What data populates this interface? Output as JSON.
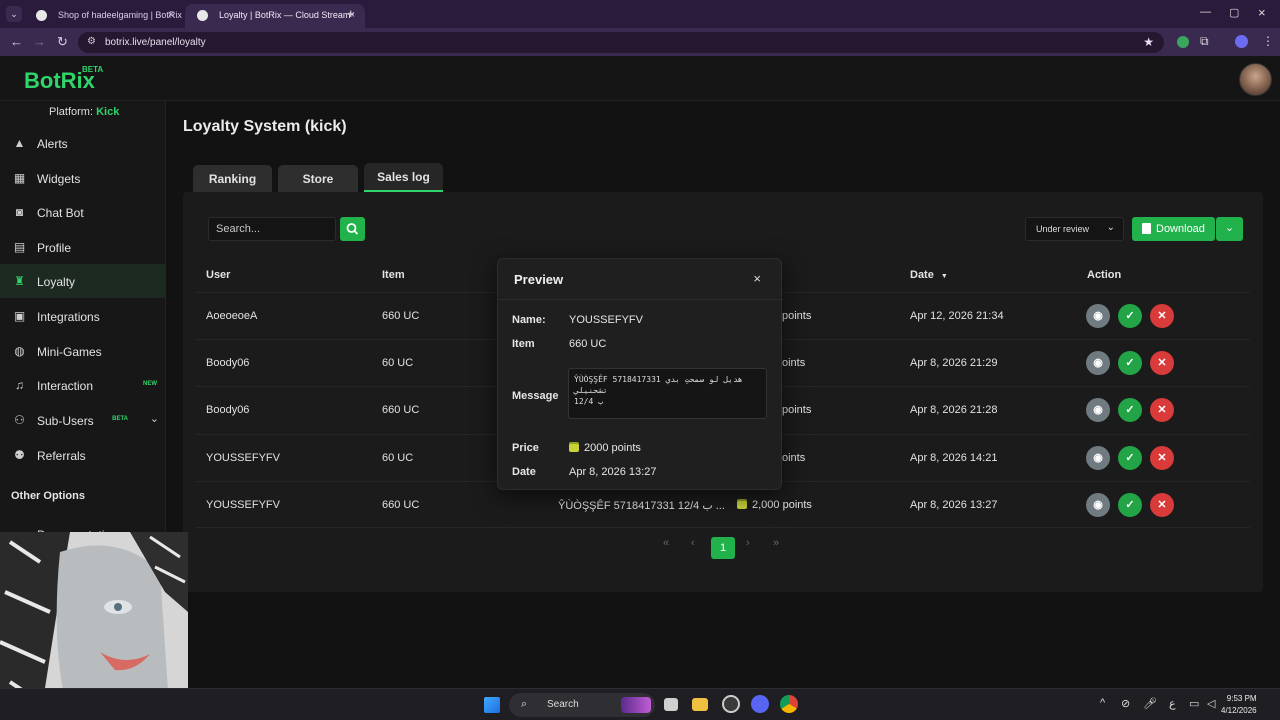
{
  "browser": {
    "tabs": [
      {
        "title": "Shop of hadeelgaming | BotRix"
      },
      {
        "title": "Loyalty | BotRix — Cloud Stream"
      }
    ],
    "url": "botrix.live/panel/loyalty"
  },
  "app": {
    "logo": "BotRix",
    "logo_badge": "BETA",
    "platform_label": "Platform:",
    "platform_value": "Kick"
  },
  "sidebar": {
    "items": [
      {
        "label": "Alerts",
        "icon": "warning-icon"
      },
      {
        "label": "Widgets",
        "icon": "widgets-icon"
      },
      {
        "label": "Chat Bot",
        "icon": "robot-icon"
      },
      {
        "label": "Profile",
        "icon": "profile-card-icon"
      },
      {
        "label": "Loyalty",
        "icon": "trophy-icon"
      },
      {
        "label": "Integrations",
        "icon": "integrations-icon"
      },
      {
        "label": "Mini-Games",
        "icon": "gamepad-icon"
      },
      {
        "label": "Interaction",
        "icon": "music-icon",
        "badge": "NEW"
      },
      {
        "label": "Sub-Users",
        "icon": "users-icon",
        "badge": "BETA"
      },
      {
        "label": "Referrals",
        "icon": "referrals-icon"
      }
    ],
    "section_other": "Other Options",
    "documentation": "Documentation"
  },
  "main": {
    "title": "Loyalty System (kick)",
    "tabs": [
      "Ranking",
      "Store",
      "Sales log"
    ],
    "search_placeholder": "Search...",
    "filter_value": "Under review",
    "download_label": "Download",
    "columns": {
      "user": "User",
      "item": "Item",
      "date": "Date",
      "action": "Action"
    },
    "rows": [
      {
        "user": "AoeoeoeA",
        "item": "660 UC",
        "message": "",
        "price": "points",
        "date": "Apr 12, 2026 21:34"
      },
      {
        "user": "Boody06",
        "item": "60 UC",
        "message": "",
        "price": "oints",
        "date": "Apr 8, 2026 21:29"
      },
      {
        "user": "Boody06",
        "item": "660 UC",
        "message": "",
        "price": "points",
        "date": "Apr 8, 2026 21:28"
      },
      {
        "user": "YOUSSEFYFV",
        "item": "60 UC",
        "message": "",
        "price": "oints",
        "date": "Apr 8, 2026 14:21"
      },
      {
        "user": "YOUSSEFYFV",
        "item": "660 UC",
        "message": "ŶÙÒŞŞÊF 5718417331 12/4 ب ...",
        "price": "2,000 points",
        "date": "Apr 8, 2026 13:27"
      }
    ],
    "pagination": {
      "first": "«",
      "prev": "‹",
      "current": "1",
      "next": "›",
      "last": "»"
    }
  },
  "preview": {
    "title": "Preview",
    "close": "×",
    "name_label": "Name:",
    "name_value": "YOUSSEFYFV",
    "item_label": "Item",
    "item_value": "660 UC",
    "message_label": "Message",
    "message_value": "ŶÙÒŞŞÊF 5718417331 هديل لو سمحتِ بدي تشحنيلي\n12/4 ب",
    "price_label": "Price",
    "price_value": "2000 points",
    "date_label": "Date",
    "date_value": "Apr 8, 2026 13:27"
  },
  "taskbar": {
    "search": "Search",
    "tray_lang": "ع",
    "time": "9:53 PM",
    "date": "4/12/2026"
  },
  "colors": {
    "accent": "#2fd46a",
    "button_green": "#22b24c",
    "danger": "#d93a3a",
    "background": "#121212"
  }
}
